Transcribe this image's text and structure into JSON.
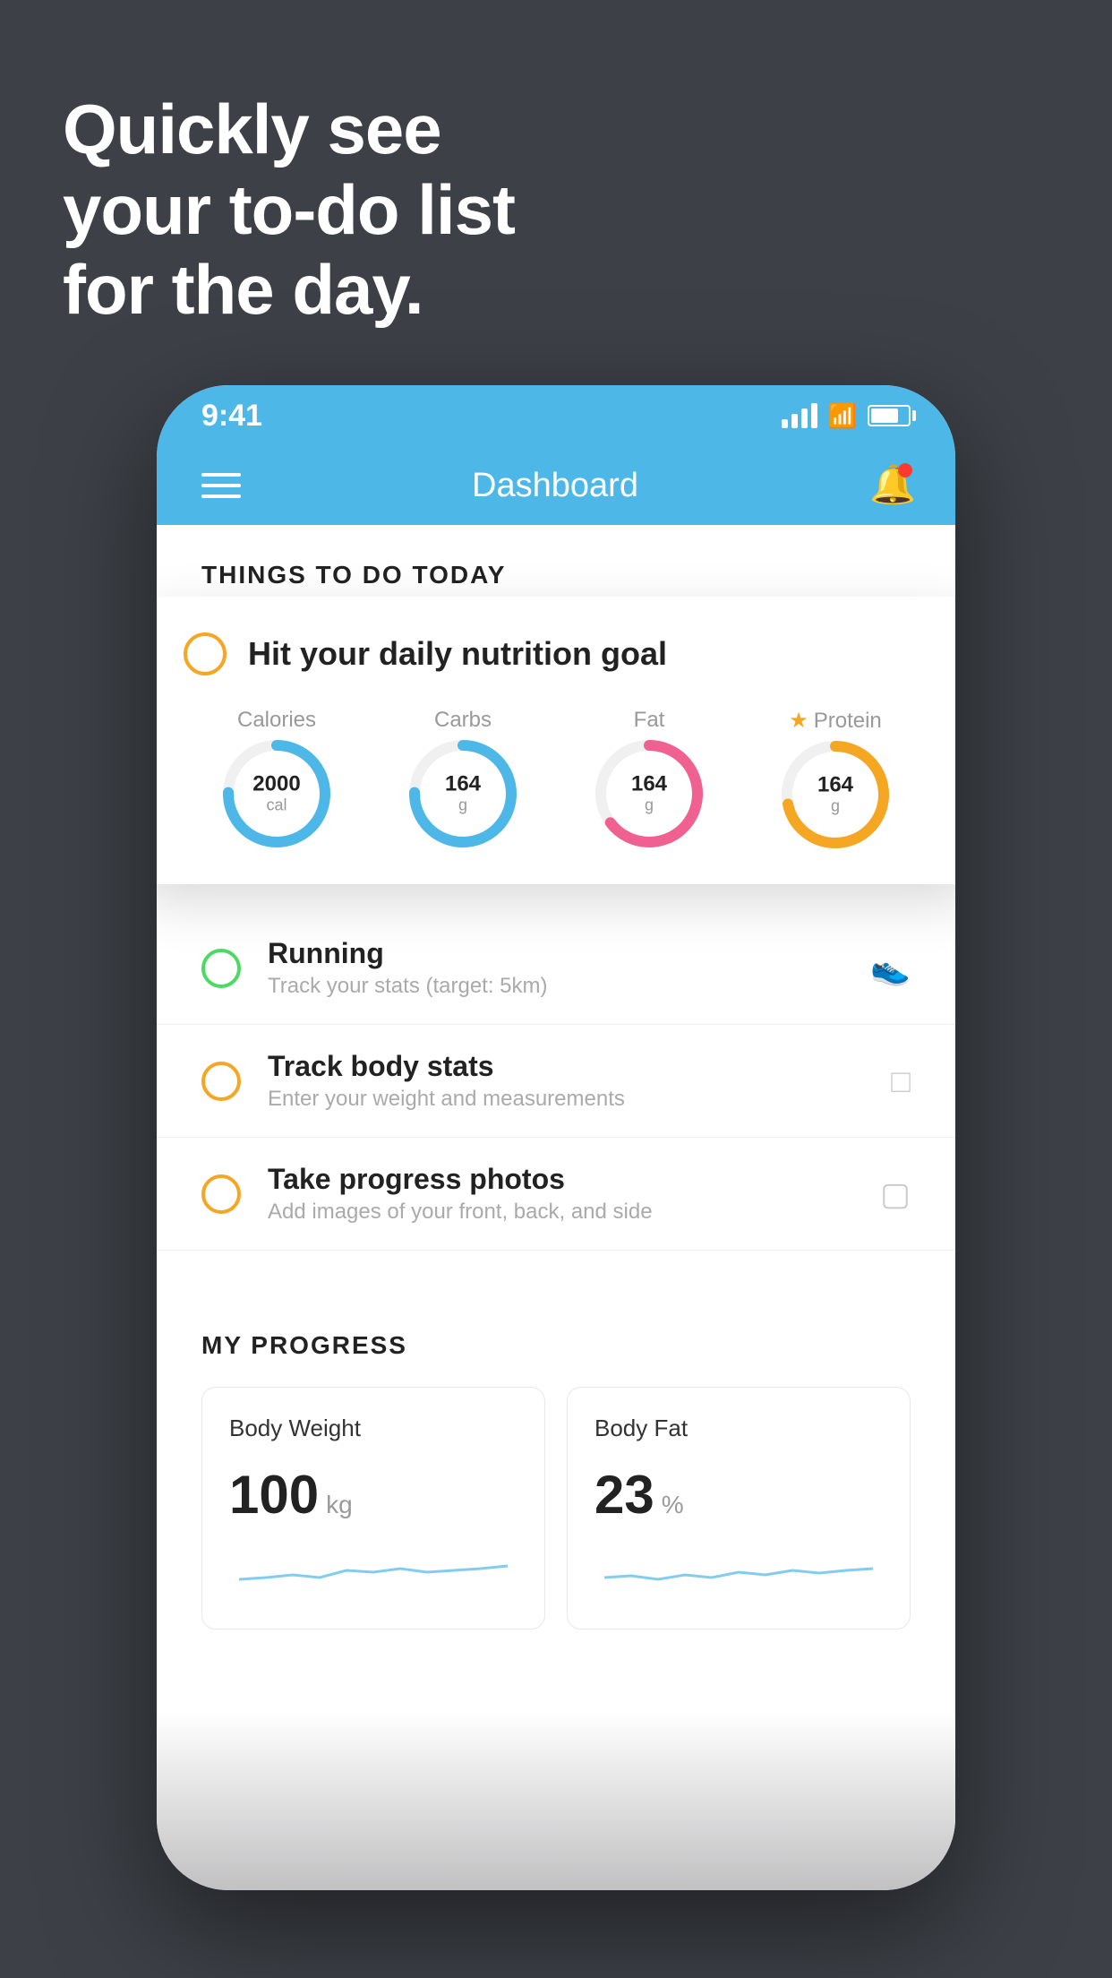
{
  "headline": {
    "line1": "Quickly see",
    "line2": "your to-do list",
    "line3": "for the day."
  },
  "phone": {
    "status_bar": {
      "time": "9:41"
    },
    "nav": {
      "title": "Dashboard"
    },
    "things_section": {
      "title": "THINGS TO DO TODAY"
    },
    "floating_card": {
      "title": "Hit your daily nutrition goal",
      "nutrition": [
        {
          "label": "Calories",
          "value": "2000",
          "unit": "cal",
          "color": "blue"
        },
        {
          "label": "Carbs",
          "value": "164",
          "unit": "g",
          "color": "blue"
        },
        {
          "label": "Fat",
          "value": "164",
          "unit": "g",
          "color": "pink"
        },
        {
          "label": "Protein",
          "value": "164",
          "unit": "g",
          "color": "gold",
          "star": true
        }
      ]
    },
    "todo_items": [
      {
        "name": "Running",
        "desc": "Track your stats (target: 5km)",
        "circle_color": "green",
        "icon": "shoe"
      },
      {
        "name": "Track body stats",
        "desc": "Enter your weight and measurements",
        "circle_color": "yellow",
        "icon": "scale"
      },
      {
        "name": "Take progress photos",
        "desc": "Add images of your front, back, and side",
        "circle_color": "yellow",
        "icon": "camera"
      }
    ],
    "progress_section": {
      "title": "MY PROGRESS",
      "cards": [
        {
          "title": "Body Weight",
          "value": "100",
          "unit": "kg"
        },
        {
          "title": "Body Fat",
          "value": "23",
          "unit": "%"
        }
      ]
    }
  }
}
